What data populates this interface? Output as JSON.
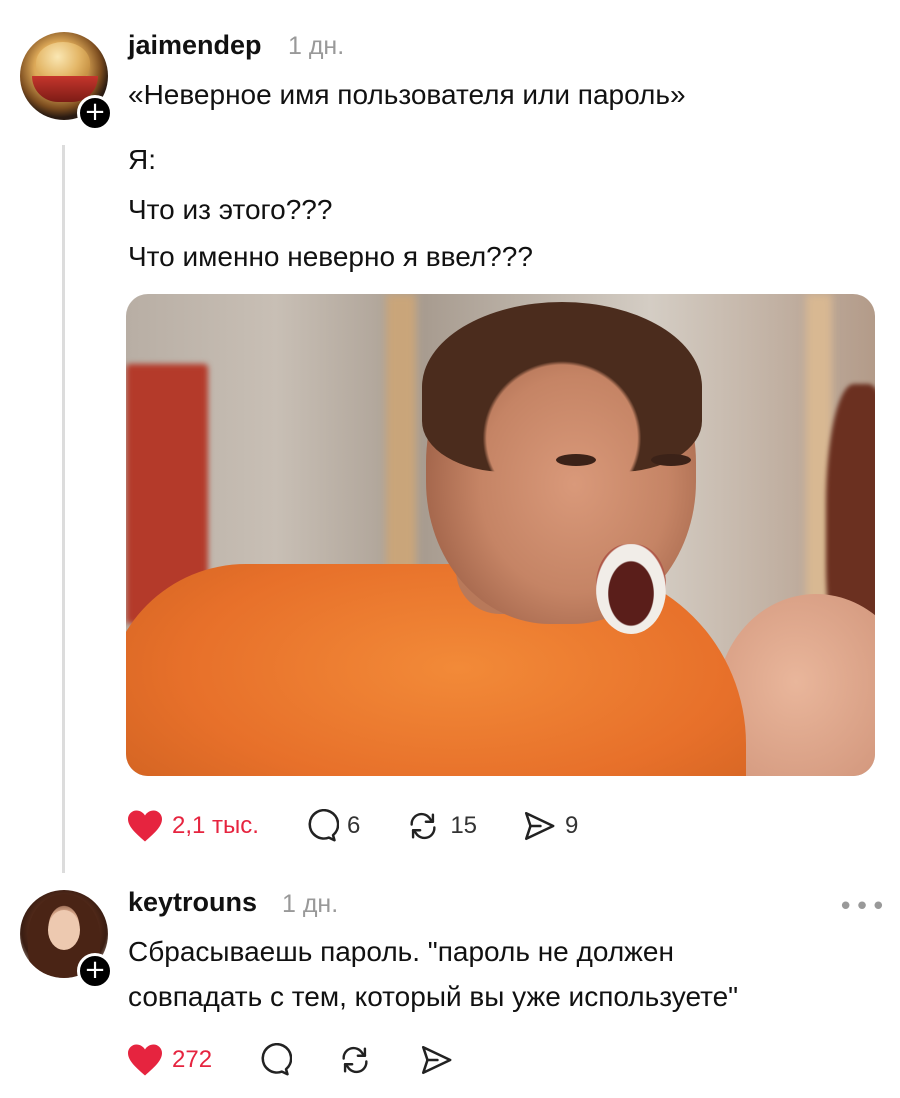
{
  "post": {
    "username": "jaimendep",
    "time": "1 дн.",
    "lines": [
      "«Неверное имя пользователя или пароль»",
      "Я:",
      "Что из этого???",
      "Что именно неверно я ввел???"
    ],
    "likes": "2,1 тыс.",
    "comments": "6",
    "reposts": "15",
    "shares": "9"
  },
  "reply": {
    "username": "keytrouns",
    "time": "1 дн.",
    "lines": [
      "Сбрасываешь пароль. \"пароль не должен",
      "совпадать с тем, который вы уже используете\""
    ],
    "likes": "272"
  },
  "colors": {
    "heart": "#e6243f",
    "muted": "#999999",
    "thread_line": "#dcdcdc"
  },
  "icons": [
    "plus-icon",
    "heart-icon",
    "comment-icon",
    "repost-icon",
    "share-icon",
    "more-icon"
  ]
}
